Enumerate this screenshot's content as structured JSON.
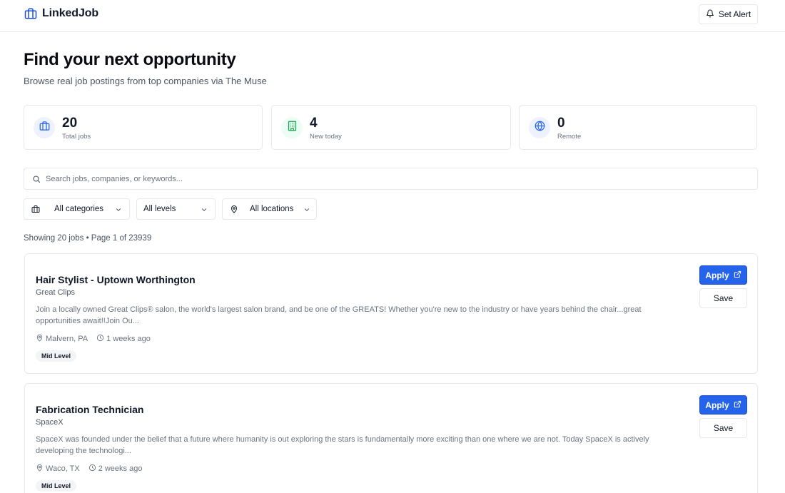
{
  "header": {
    "brand": "LinkedJob",
    "alert_label": "Set Alert"
  },
  "hero": {
    "title": "Find your next opportunity",
    "subtitle": "Browse real job postings from top companies via The Muse"
  },
  "stats": [
    {
      "value": "20",
      "label": "Total jobs",
      "icon": "briefcase-icon"
    },
    {
      "value": "4",
      "label": "New today",
      "icon": "building-icon"
    },
    {
      "value": "0",
      "label": "Remote",
      "icon": "globe-icon"
    }
  ],
  "search": {
    "placeholder": "Search jobs, companies, or keywords...",
    "value": ""
  },
  "filters": {
    "category": "All categories",
    "level": "All levels",
    "location": "All locations"
  },
  "results_text": "Showing 20 jobs • Page 1 of 23939",
  "jobs": [
    {
      "title": "Hair Stylist - Uptown Worthington",
      "company": "Great Clips",
      "description": "Join a locally owned Great Clips® salon, the world's largest salon brand, and be one of the GREATS! Whether you're new to the industry or have years behind the chair...great opportunities await!!Join Ou...",
      "location": "Malvern, PA",
      "posted": "1 weeks ago",
      "level": "Mid Level",
      "apply_label": "Apply",
      "save_label": "Save"
    },
    {
      "title": "Fabrication Technician",
      "company": "SpaceX",
      "description": "SpaceX was founded under the belief that a future where humanity is out exploring the stars is fundamentally more exciting than one where we are not. Today SpaceX is actively developing the technologi...",
      "location": "Waco, TX",
      "posted": "2 weeks ago",
      "level": "Mid Level",
      "apply_label": "Apply",
      "save_label": "Save"
    }
  ],
  "colors": {
    "accent": "#2563eb",
    "brand_icon": "#1d4ed8",
    "stat_blue_bg": "#eef2ff",
    "stat_green_bg": "#ecfdf5",
    "stat_green": "#16a34a",
    "border": "#e5e7eb"
  }
}
